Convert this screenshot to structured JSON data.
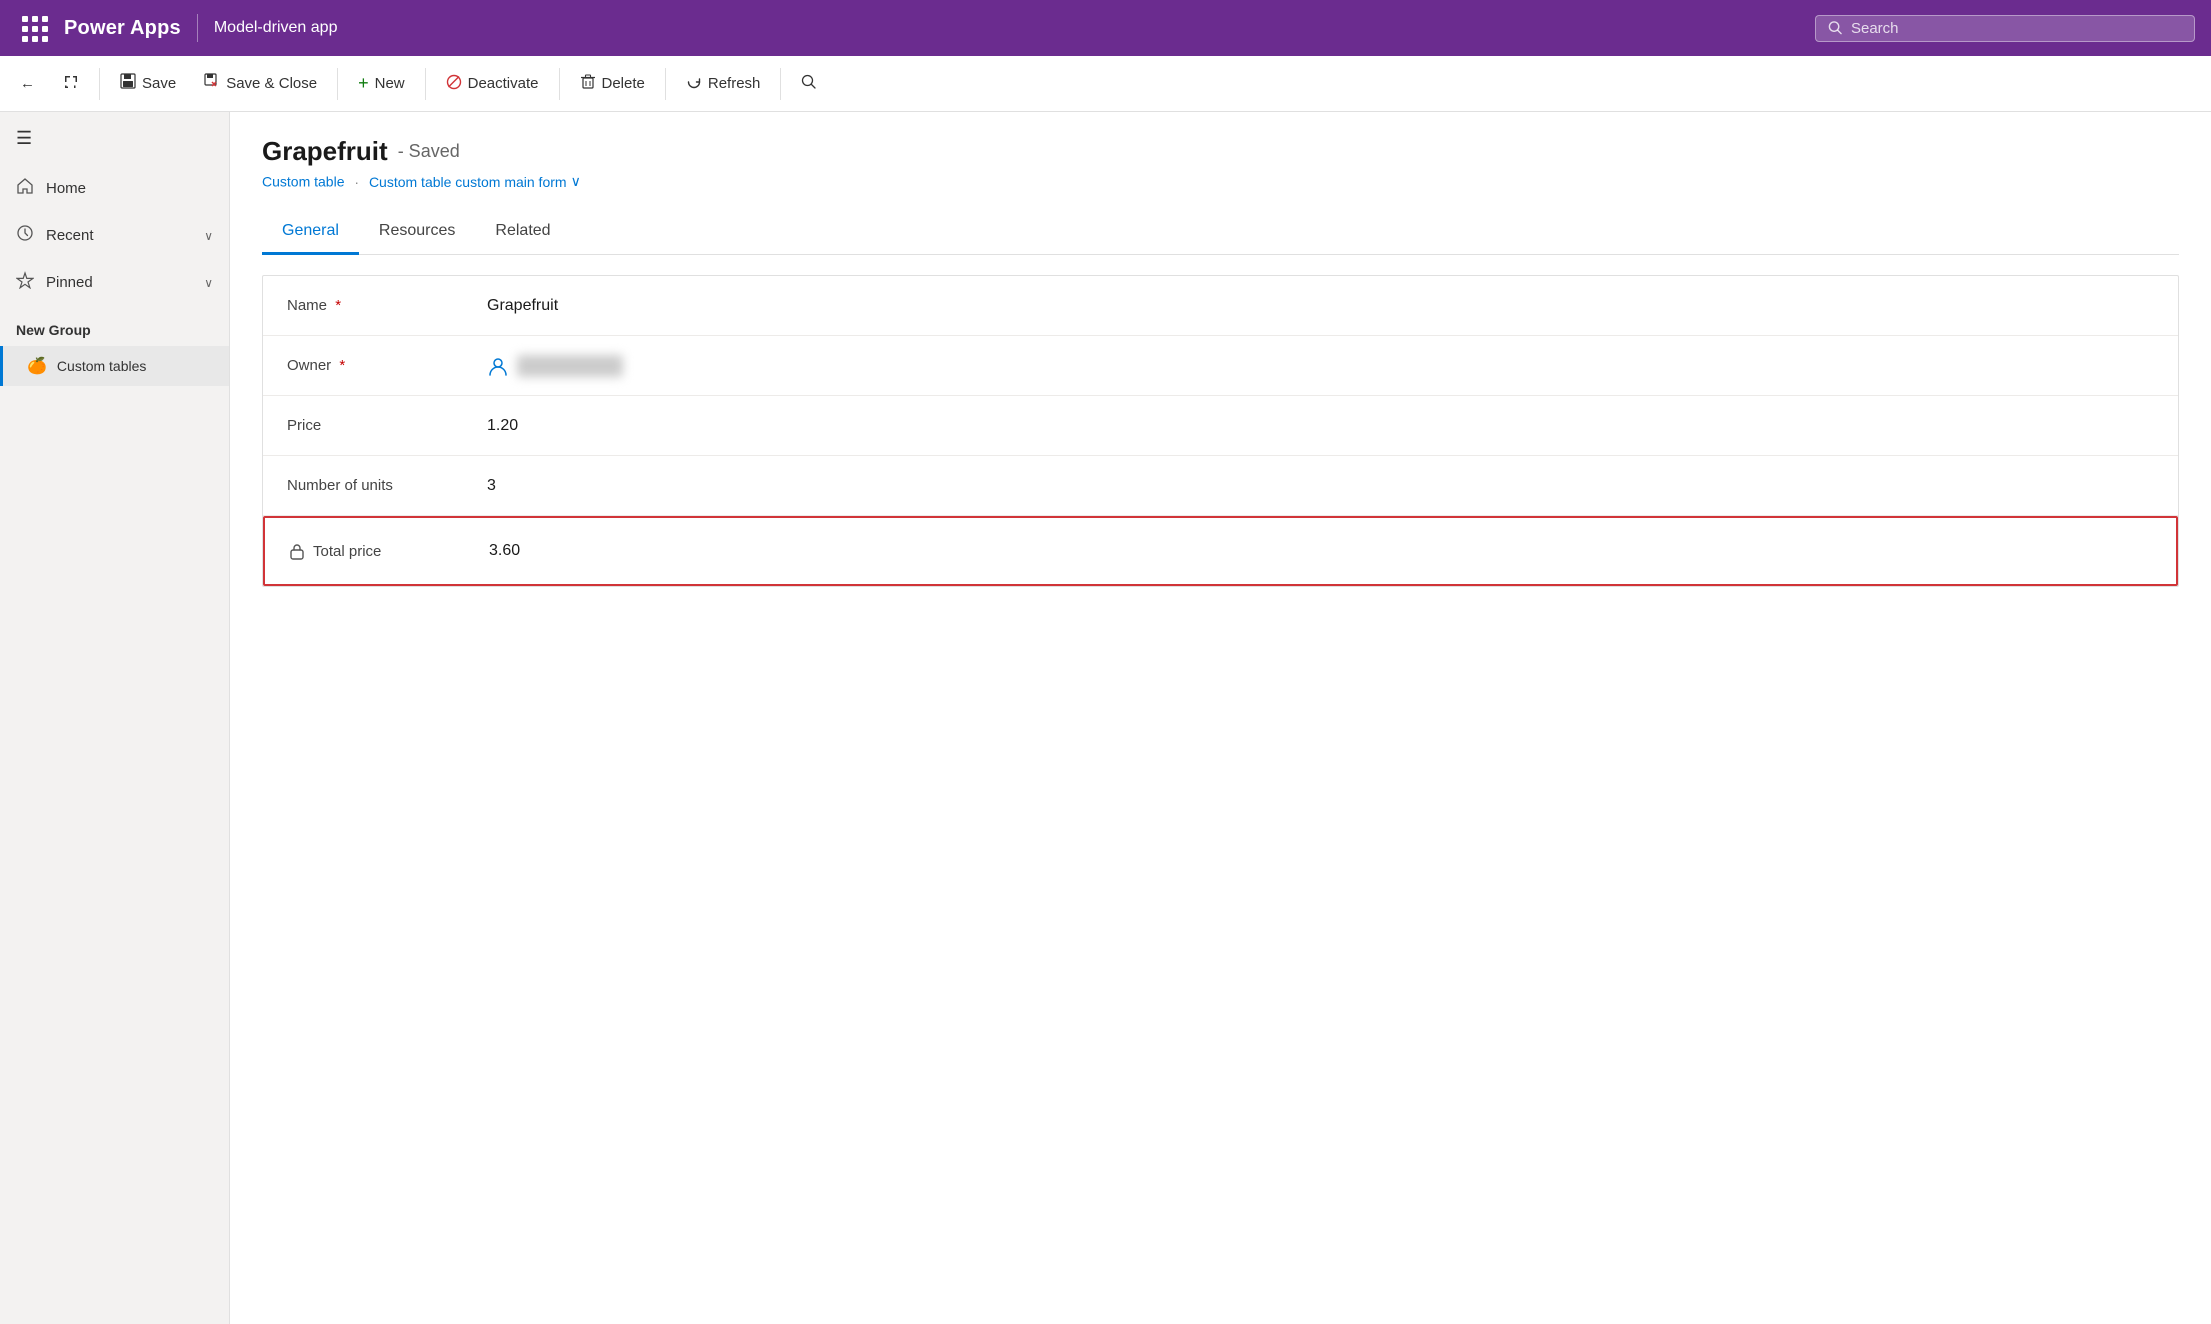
{
  "topbar": {
    "logo": "Power Apps",
    "app_name": "Model-driven app",
    "search_placeholder": "Search"
  },
  "commandbar": {
    "back_label": "←",
    "expand_label": "⤢",
    "save_label": "Save",
    "save_close_label": "Save & Close",
    "new_label": "New",
    "deactivate_label": "Deactivate",
    "delete_label": "Delete",
    "refresh_label": "Refresh",
    "search_label": "🔍"
  },
  "sidebar": {
    "hamburger_label": "☰",
    "home_label": "Home",
    "recent_label": "Recent",
    "pinned_label": "Pinned",
    "new_group_label": "New Group",
    "custom_tables_label": "Custom tables"
  },
  "record": {
    "name": "Grapefruit",
    "status": "- Saved",
    "breadcrumb_table": "Custom table",
    "breadcrumb_form": "Custom table custom main form",
    "tabs": [
      {
        "id": "general",
        "label": "General",
        "active": true
      },
      {
        "id": "resources",
        "label": "Resources",
        "active": false
      },
      {
        "id": "related",
        "label": "Related",
        "active": false
      }
    ],
    "fields": [
      {
        "id": "name",
        "label": "Name",
        "required": true,
        "value": "Grapefruit",
        "type": "text"
      },
      {
        "id": "owner",
        "label": "Owner",
        "required": true,
        "value": "████████████",
        "type": "owner"
      },
      {
        "id": "price",
        "label": "Price",
        "required": false,
        "value": "1.20",
        "type": "text"
      },
      {
        "id": "units",
        "label": "Number of units",
        "required": false,
        "value": "3",
        "type": "text"
      },
      {
        "id": "total_price",
        "label": "Total price",
        "required": false,
        "value": "3.60",
        "type": "calculated",
        "highlighted": true
      }
    ]
  },
  "icons": {
    "home": "⌂",
    "recent": "◷",
    "pinned": "✦",
    "save": "💾",
    "save_close": "📋",
    "new": "+",
    "deactivate": "⊘",
    "delete": "🗑",
    "refresh": "↻",
    "lock": "🔒",
    "user": "👤",
    "chevron_down": "∨",
    "search": "🔍",
    "emoji_fruit": "🍊"
  }
}
